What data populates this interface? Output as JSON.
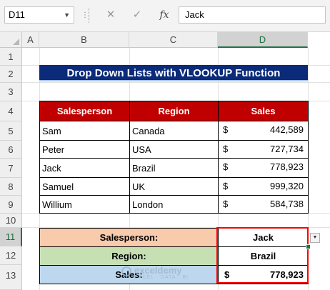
{
  "formula_bar": {
    "name_box": "D11",
    "cancel_glyph": "✕",
    "enter_glyph": "✓",
    "fx_label": "fx",
    "formula": "Jack"
  },
  "columns": [
    "A",
    "B",
    "C",
    "D"
  ],
  "rows": [
    "1",
    "2",
    "3",
    "4",
    "5",
    "6",
    "7",
    "8",
    "9",
    "10",
    "11",
    "12",
    "13"
  ],
  "selected": {
    "column": "D",
    "row": "11"
  },
  "title": "Drop Down Lists with VLOOKUP Function",
  "table": {
    "headers": {
      "salesperson": "Salesperson",
      "region": "Region",
      "sales": "Sales"
    },
    "currency_symbol": "$",
    "rows": [
      {
        "salesperson": "Sam",
        "region": "Canada",
        "sales": "442,589"
      },
      {
        "salesperson": "Peter",
        "region": "USA",
        "sales": "727,734"
      },
      {
        "salesperson": "Jack",
        "region": "Brazil",
        "sales": "778,923"
      },
      {
        "salesperson": "Samuel",
        "region": "UK",
        "sales": "999,320"
      },
      {
        "salesperson": "Willium",
        "region": "London",
        "sales": "584,738"
      }
    ]
  },
  "lookup": {
    "salesperson_label": "Salesperson:",
    "salesperson_value": "Jack",
    "region_label": "Region:",
    "region_value": "Brazil",
    "sales_label": "Sales:",
    "sales_symbol": "$",
    "sales_value": "778,923"
  },
  "watermark": {
    "name": "exceldemy",
    "tagline": "EXCEL · DATA · BI"
  },
  "colors": {
    "title_bg": "#0b2b7a",
    "header_bg": "#c00000",
    "salesperson_fill": "#f8cbad",
    "region_fill": "#c6e0b4",
    "sales_fill": "#bdd7ee",
    "highlight_border": "#ff0000",
    "excel_green": "#217346"
  }
}
